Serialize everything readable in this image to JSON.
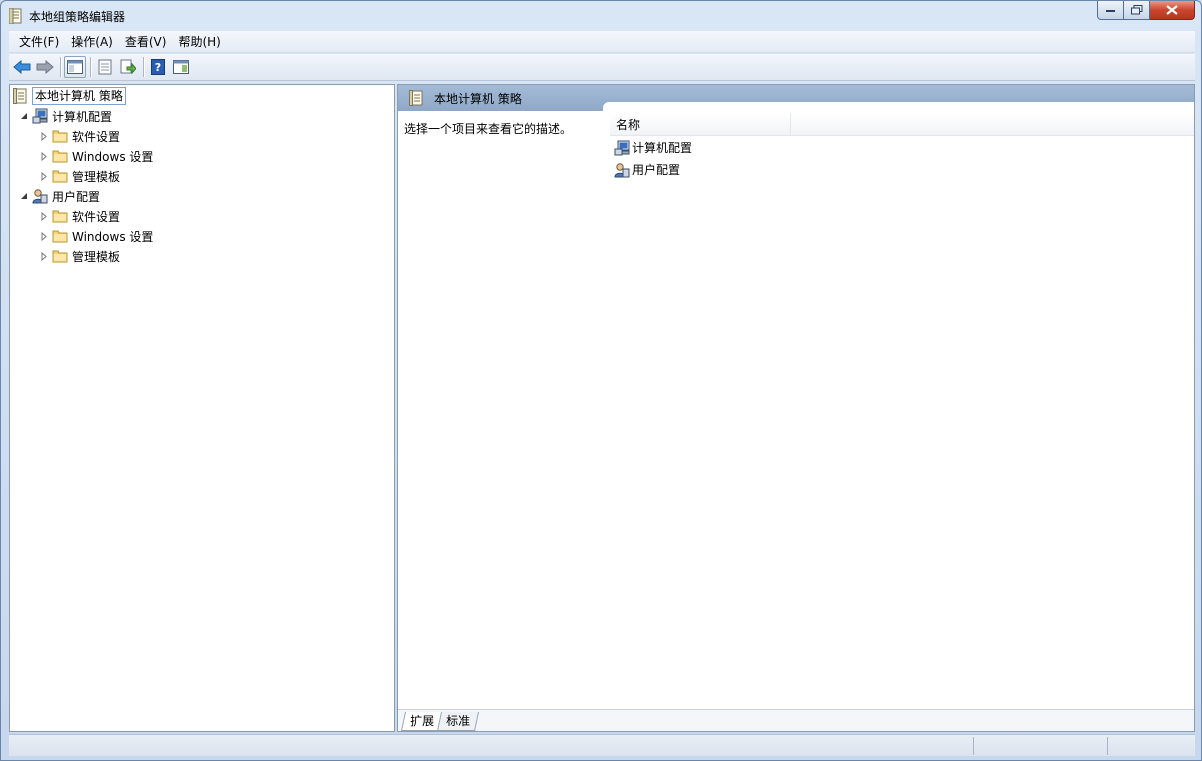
{
  "window": {
    "title": "本地组策略编辑器"
  },
  "menu": {
    "items": [
      "文件(F)",
      "操作(A)",
      "查看(V)",
      "帮助(H)"
    ]
  },
  "toolbar": {
    "buttons": [
      "back-icon",
      "forward-icon",
      "show-hide-tree-icon",
      "properties-icon",
      "export-list-icon",
      "help-icon",
      "show-hide-action-pane-icon"
    ]
  },
  "tree": {
    "root": "本地计算机 策略",
    "computer": {
      "label": "计算机配置",
      "children": [
        "软件设置",
        "Windows 设置",
        "管理模板"
      ]
    },
    "user": {
      "label": "用户配置",
      "children": [
        "软件设置",
        "Windows 设置",
        "管理模板"
      ]
    }
  },
  "detail": {
    "header": "本地计算机 策略",
    "description": "选择一个项目来查看它的描述。",
    "column_name": "名称",
    "rows": [
      "计算机配置",
      "用户配置"
    ]
  },
  "tabs": [
    "扩展",
    "标准"
  ],
  "colors": {
    "header_blue": "#8fa8c7",
    "folder_yellow": "#f2d27a",
    "close_red": "#c8462e"
  }
}
